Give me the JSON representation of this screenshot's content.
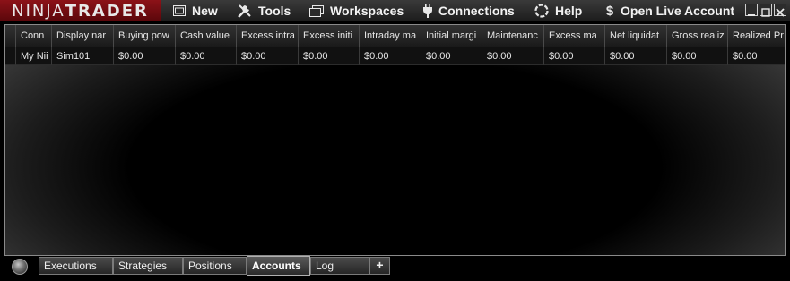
{
  "app": {
    "logo_part1": "NINJA",
    "logo_part2": "TRADER"
  },
  "menu": {
    "new": "New",
    "tools": "Tools",
    "workspaces": "Workspaces",
    "connections": "Connections",
    "help": "Help",
    "open_live_account": "Open Live Account"
  },
  "grid": {
    "columns": [
      "Conn",
      "Display nar",
      "Buying pow",
      "Cash value",
      "Excess intra",
      "Excess initi",
      "Intraday ma",
      "Initial margi",
      "Maintenanc",
      "Excess ma",
      "Net liquidat",
      "Gross realiz",
      "Realized Pr"
    ],
    "rows": [
      [
        "My Nii",
        "Sim101",
        "$0.00",
        "$0.00",
        "$0.00",
        "$0.00",
        "$0.00",
        "$0.00",
        "$0.00",
        "$0.00",
        "$0.00",
        "$0.00",
        "$0.00"
      ]
    ]
  },
  "tabs": {
    "executions": "Executions",
    "strategies": "Strategies",
    "positions": "Positions",
    "accounts": "Accounts",
    "log": "Log",
    "add": "+",
    "active": "Accounts"
  },
  "colors": {
    "logo_bg": "#7a0c12",
    "menubar_bg": "#2a2a2a",
    "grid_border": "#8a8a8a"
  }
}
